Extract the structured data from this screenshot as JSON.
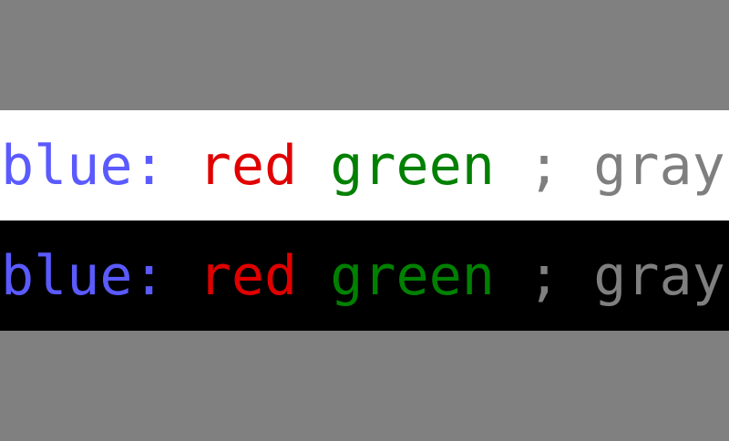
{
  "colors": {
    "background": "#808080",
    "light_band": "#ffffff",
    "dark_band": "#000000",
    "blue": "#5a5aff",
    "red": "#e00000",
    "green": "#008000",
    "gray": "#7f7f7f"
  },
  "rows": [
    {
      "band": "light",
      "tokens": [
        {
          "text": "blue:",
          "color": "blue"
        },
        {
          "text": " ",
          "color": "blue"
        },
        {
          "text": "red",
          "color": "red"
        },
        {
          "text": " ",
          "color": "red"
        },
        {
          "text": "green",
          "color": "green"
        },
        {
          "text": " ",
          "color": "gray"
        },
        {
          "text": ";",
          "color": "gray"
        },
        {
          "text": " ",
          "color": "gray"
        },
        {
          "text": "gray",
          "color": "gray"
        }
      ]
    },
    {
      "band": "dark",
      "tokens": [
        {
          "text": "blue:",
          "color": "blue"
        },
        {
          "text": " ",
          "color": "blue"
        },
        {
          "text": "red",
          "color": "red"
        },
        {
          "text": " ",
          "color": "red"
        },
        {
          "text": "green",
          "color": "green"
        },
        {
          "text": " ",
          "color": "gray"
        },
        {
          "text": ";",
          "color": "gray"
        },
        {
          "text": " ",
          "color": "gray"
        },
        {
          "text": "gray",
          "color": "gray"
        }
      ]
    }
  ]
}
